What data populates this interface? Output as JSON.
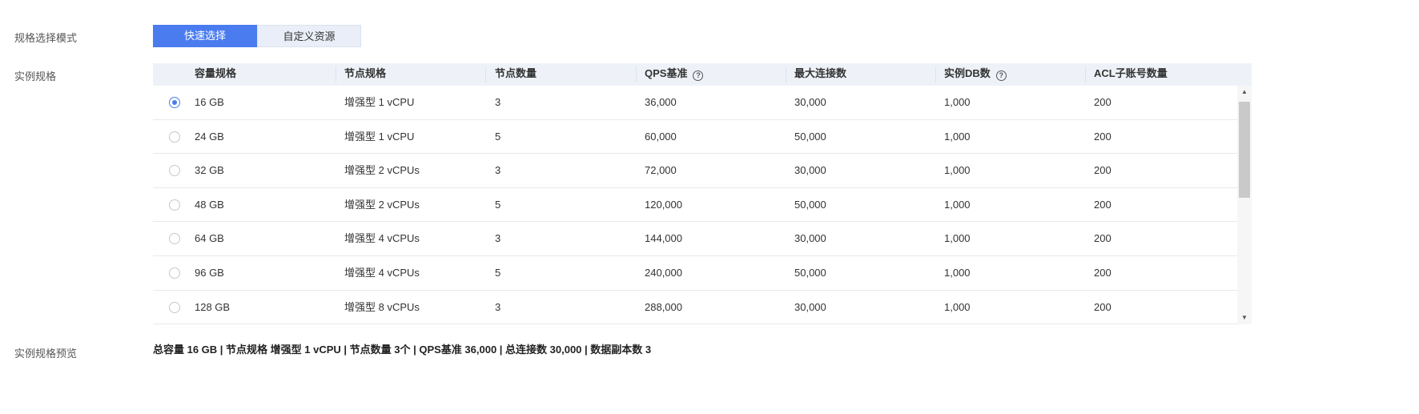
{
  "labels": {
    "mode": "规格选择模式",
    "spec": "实例规格",
    "preview": "实例规格预览"
  },
  "mode_toggle": {
    "quick": "快速选择",
    "custom": "自定义资源",
    "selected": "quick"
  },
  "table": {
    "headers": [
      "容量规格",
      "节点规格",
      "节点数量",
      "QPS基准",
      "最大连接数",
      "实例DB数",
      "ACL子账号数量"
    ],
    "help_icon_glyph": "?",
    "selected_index": 0,
    "rows": [
      [
        "16 GB",
        "增强型 1 vCPU",
        "3",
        "36,000",
        "30,000",
        "1,000",
        "200"
      ],
      [
        "24 GB",
        "增强型 1 vCPU",
        "5",
        "60,000",
        "50,000",
        "1,000",
        "200"
      ],
      [
        "32 GB",
        "增强型 2 vCPUs",
        "3",
        "72,000",
        "30,000",
        "1,000",
        "200"
      ],
      [
        "48 GB",
        "增强型 2 vCPUs",
        "5",
        "120,000",
        "50,000",
        "1,000",
        "200"
      ],
      [
        "64 GB",
        "增强型 4 vCPUs",
        "3",
        "144,000",
        "30,000",
        "1,000",
        "200"
      ],
      [
        "96 GB",
        "增强型 4 vCPUs",
        "5",
        "240,000",
        "50,000",
        "1,000",
        "200"
      ],
      [
        "128 GB",
        "增强型 8 vCPUs",
        "3",
        "288,000",
        "30,000",
        "1,000",
        "200"
      ]
    ]
  },
  "preview_text": "总容量 16 GB | 节点规格 增强型 1 vCPU | 节点数量 3个 | QPS基准 36,000 | 总连接数 30,000 | 数据副本数 3",
  "colors": {
    "accent": "#4a7cf0",
    "header_bg": "#eef2f8"
  }
}
